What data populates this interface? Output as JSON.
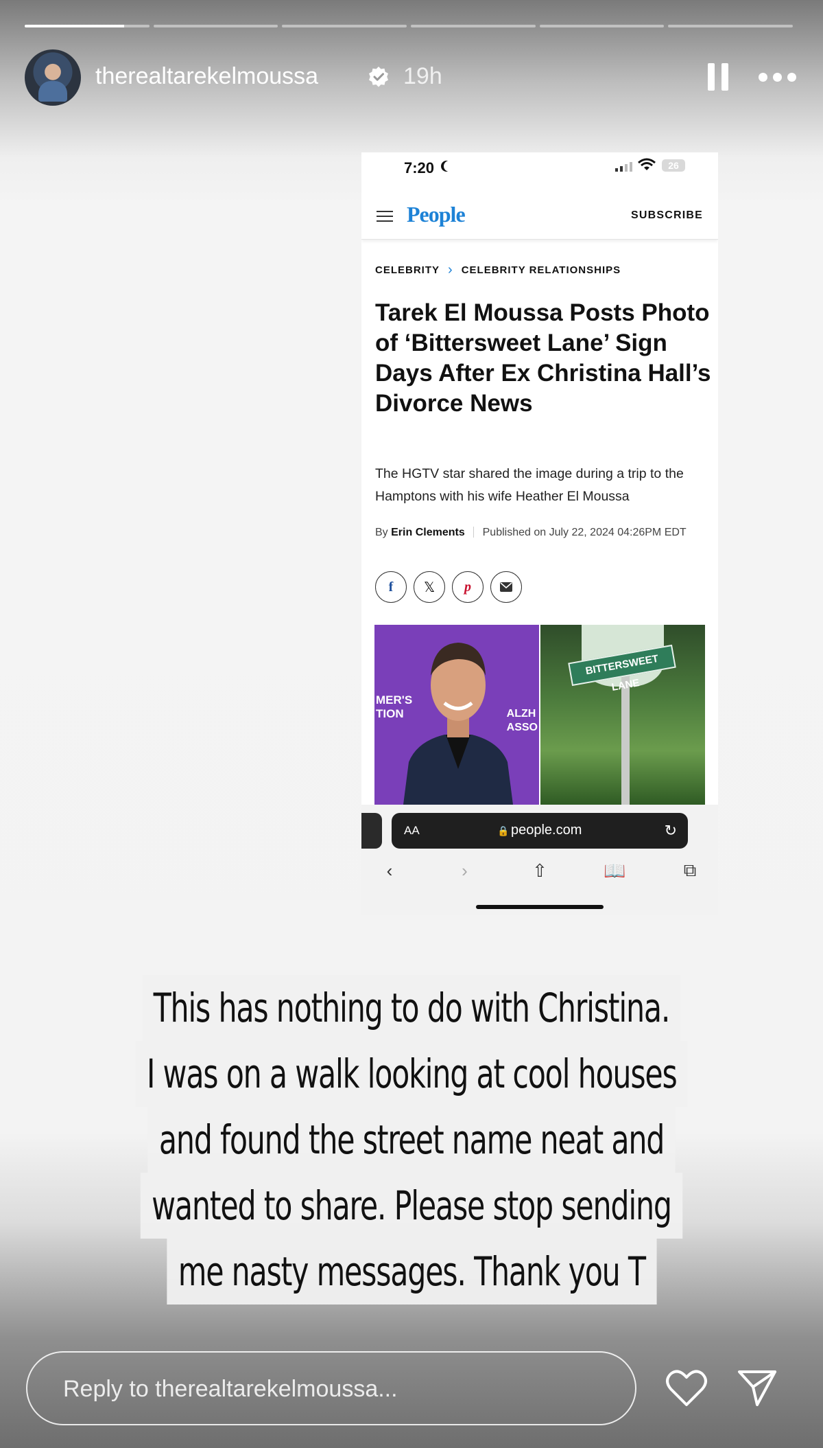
{
  "story": {
    "segments": [
      1,
      0,
      0,
      0,
      0,
      0
    ],
    "active_segment_progress": 0.8
  },
  "header": {
    "username": "therealtarekelmoussa",
    "time_ago": "19h"
  },
  "article_screenshot": {
    "status_time": "7:20",
    "battery": "26",
    "brand": "People",
    "subscribe": "SUBSCRIBE",
    "breadcrumb": [
      "CELEBRITY",
      "CELEBRITY RELATIONSHIPS"
    ],
    "headline": "Tarek El Moussa Posts Photo of ‘Bittersweet Lane’ Sign Days After Ex Christina Hall’s Divorce News",
    "dek": "The HGTV star shared the image during a trip to the Hamptons with his wife Heather El Moussa",
    "byline_prefix": "By",
    "author": "Erin Clements",
    "published": "Published on July 22, 2024 04:26PM EDT",
    "share_icons": [
      "facebook-icon",
      "x-icon",
      "pinterest-icon",
      "email-icon"
    ],
    "photo_left_text_1": "MER'S",
    "photo_left_text_2": "TION",
    "photo_left_text_3": "ALZH",
    "photo_left_text_4": "ASSO",
    "street_sign": "BITTERSWEET LANE",
    "browser": {
      "aa_label": "AA",
      "domain": "people.com"
    }
  },
  "caption": {
    "lines": [
      "This has nothing to do with Christina.",
      "I was on a walk looking at cool houses",
      "and found the street name neat and",
      "wanted to share. Please stop sending",
      "me nasty messages. Thank you T"
    ]
  },
  "reply": {
    "placeholder": "Reply to therealtarekelmoussa..."
  }
}
